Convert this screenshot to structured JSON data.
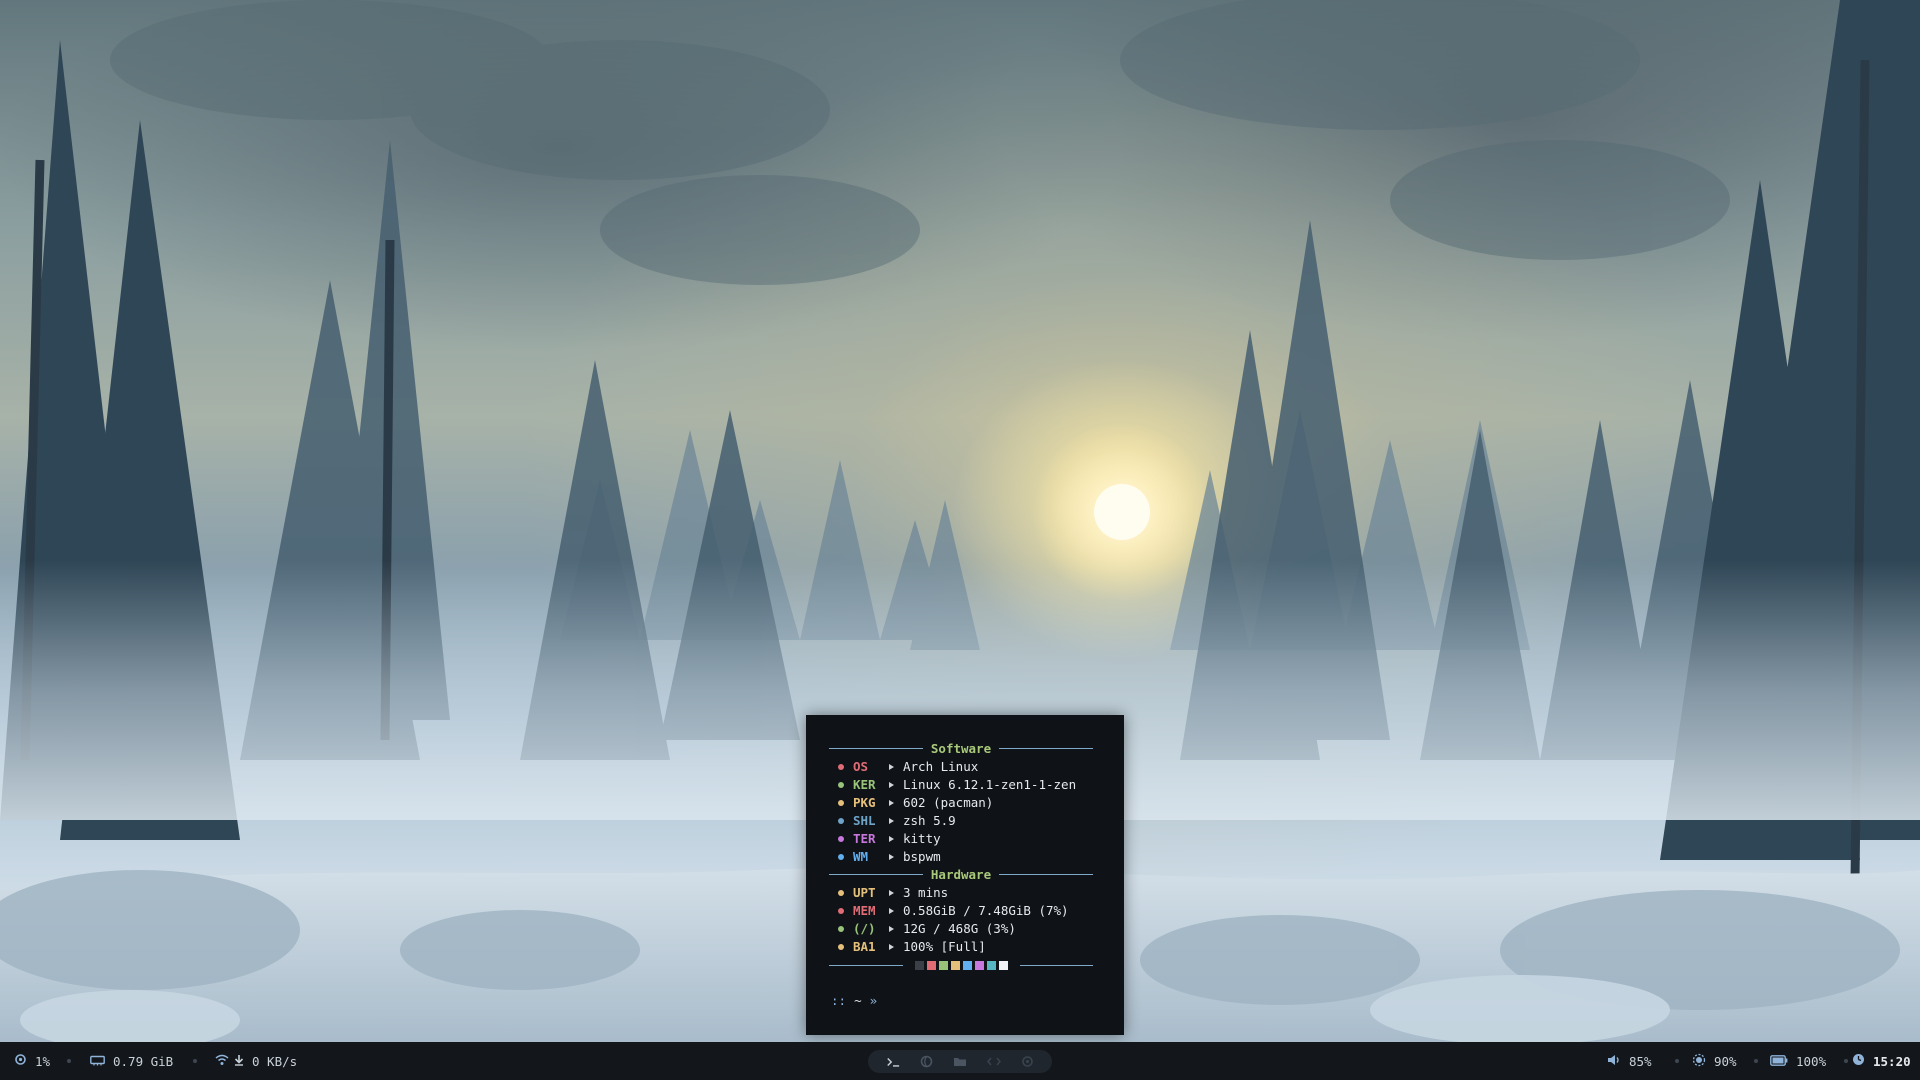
{
  "terminal": {
    "software_title": "Software",
    "hardware_title": "Hardware",
    "software_rows": [
      {
        "key": "OS",
        "value": "Arch Linux",
        "color": "#e06c75"
      },
      {
        "key": "KER",
        "value": "Linux 6.12.1-zen1-1-zen",
        "color": "#98c379"
      },
      {
        "key": "PKG",
        "value": "602 (pacman)",
        "color": "#e5c07b"
      },
      {
        "key": "SHL",
        "value": "zsh 5.9",
        "color": "#6fa3c8"
      },
      {
        "key": "TER",
        "value": "kitty",
        "color": "#c678dd"
      },
      {
        "key": "WM",
        "value": "bspwm",
        "color": "#61afef"
      }
    ],
    "hardware_rows": [
      {
        "key": "UPT",
        "value": "3 mins",
        "color": "#e5c07b"
      },
      {
        "key": "MEM",
        "value": "0.58GiB / 7.48GiB (7%)",
        "color": "#e06c75"
      },
      {
        "key": "(/)",
        "value": "12G / 468G (3%)",
        "color": "#98c379"
      },
      {
        "key": "BA1",
        "value": "100% [Full]",
        "color": "#e5c07b"
      }
    ],
    "palette": [
      "#3b4048",
      "#e06c75",
      "#98c379",
      "#e5c07b",
      "#61afef",
      "#c678dd",
      "#56b6c2",
      "#f0f2f5"
    ],
    "prompt": {
      "dots": "::",
      "tilde": "~",
      "chevron": "»"
    }
  },
  "bar": {
    "cpu": "1%",
    "memory": "0.79 GiB",
    "network": "0 KB/s",
    "volume": "85%",
    "brightness": "90%",
    "battery": "100%",
    "clock": "15:20",
    "workspaces": [
      {
        "icon": "terminal-icon",
        "active": true
      },
      {
        "icon": "browser-icon",
        "active": false
      },
      {
        "icon": "folder-icon",
        "active": false
      },
      {
        "icon": "code-icon",
        "active": false
      },
      {
        "icon": "chat-icon",
        "active": false
      }
    ],
    "colors": {
      "accent": "#8fb3d9",
      "background": "#13171c"
    }
  }
}
